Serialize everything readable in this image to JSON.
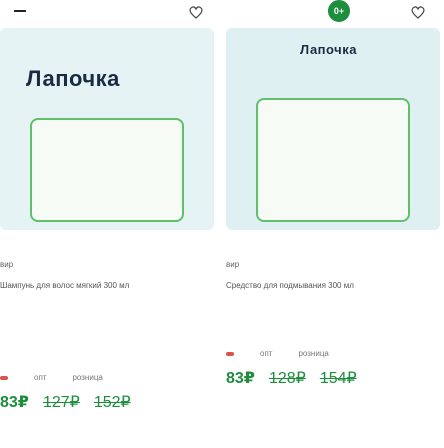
{
  "cards": [
    {
      "age_badge": "",
      "brand": "Лапочка",
      "product_name": "вир",
      "desc": "Шампунь для волос мягкий 300 мл",
      "discount": "",
      "tag1": "опт",
      "tag2": "розница",
      "price": "83₽",
      "old_price1": "127₽",
      "old_price2": "152₽"
    },
    {
      "age_badge": "0+",
      "brand": "Лапочка",
      "product_name": "вир",
      "desc": "Средство для подмывания 300 мл",
      "discount": "",
      "tag1": "опт",
      "tag2": "розница",
      "price": "83₽",
      "old_price1": "128₽",
      "old_price2": "154₽"
    }
  ]
}
